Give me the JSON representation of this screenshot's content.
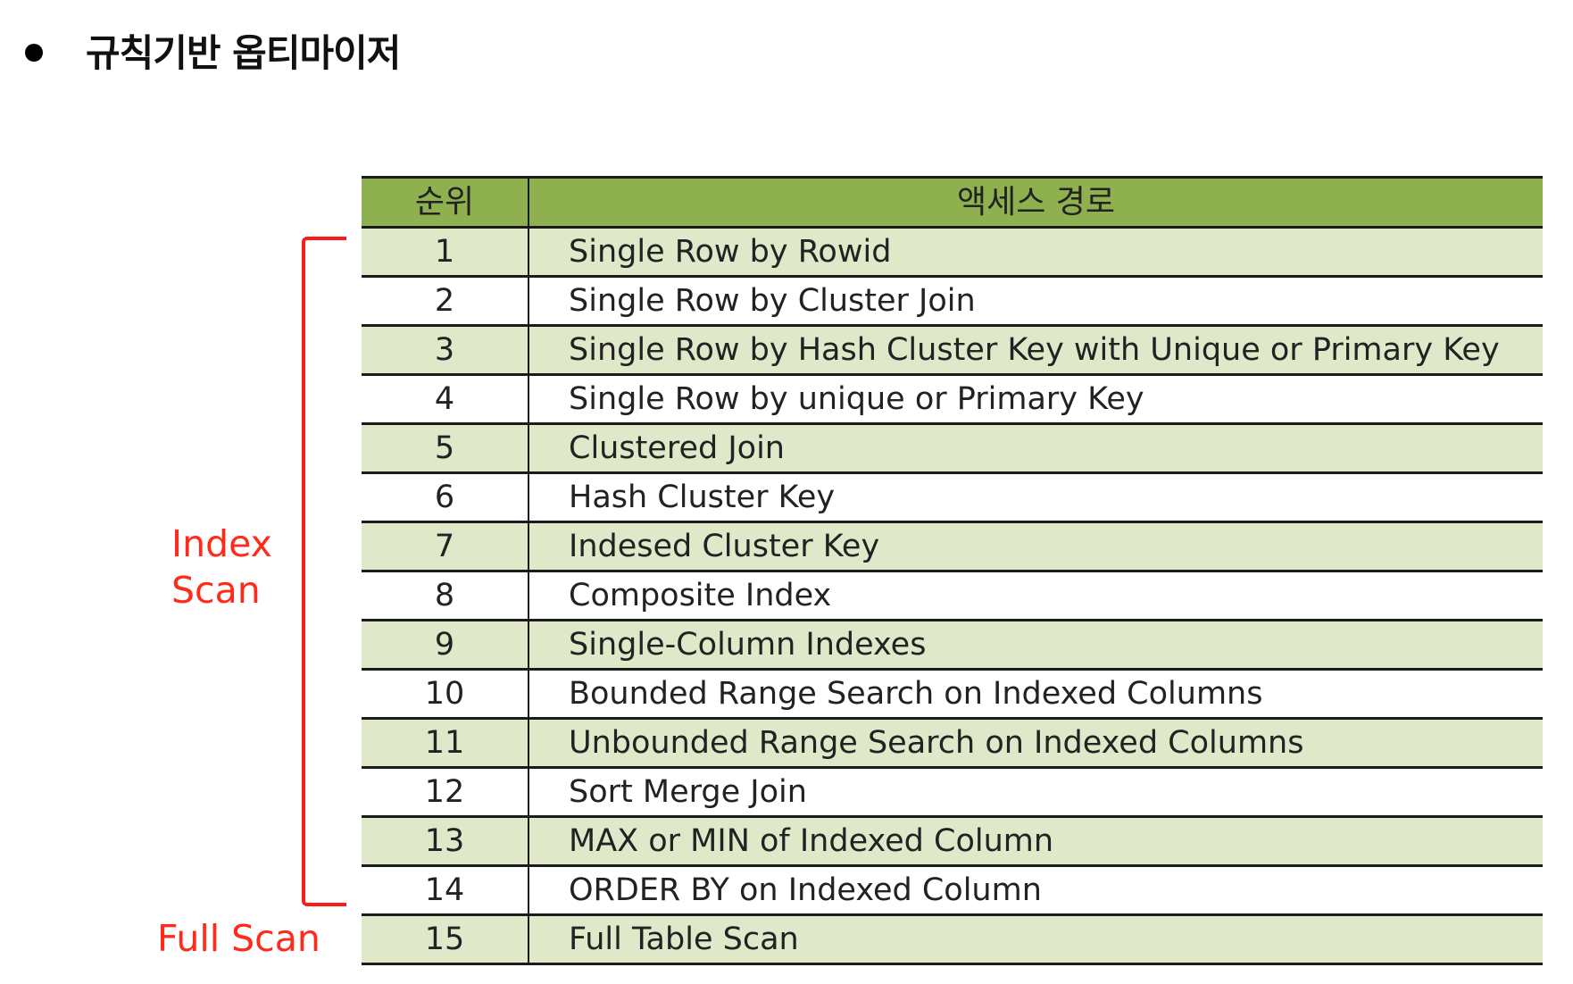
{
  "heading": "규칙기반 옵티마이저",
  "table": {
    "headers": {
      "rank": "순위",
      "path": "액세스 경로"
    },
    "rows": [
      {
        "rank": "1",
        "path": "Single Row by Rowid"
      },
      {
        "rank": "2",
        "path": "Single Row by Cluster Join"
      },
      {
        "rank": "3",
        "path": "Single Row by Hash Cluster Key with Unique or Primary Key"
      },
      {
        "rank": "4",
        "path": "Single Row by unique or Primary Key"
      },
      {
        "rank": "5",
        "path": "Clustered Join"
      },
      {
        "rank": "6",
        "path": "Hash Cluster Key"
      },
      {
        "rank": "7",
        "path": "Indesed Cluster Key"
      },
      {
        "rank": "8",
        "path": "Composite Index"
      },
      {
        "rank": "9",
        "path": "Single-Column Indexes"
      },
      {
        "rank": "10",
        "path": "Bounded Range Search on Indexed Columns"
      },
      {
        "rank": "11",
        "path": "Unbounded Range Search on Indexed Columns"
      },
      {
        "rank": "12",
        "path": "Sort Merge Join"
      },
      {
        "rank": "13",
        "path": "MAX or MIN of Indexed Column"
      },
      {
        "rank": "14",
        "path": "ORDER BY on Indexed Column"
      },
      {
        "rank": "15",
        "path": "Full Table Scan"
      }
    ]
  },
  "annotations": {
    "index_scan_line1": "Index",
    "index_scan_line2": "Scan",
    "full_scan": "Full Scan",
    "color": "#ff2a1a"
  },
  "colors": {
    "header_bg": "#8fb04e",
    "odd_row_bg": "#dfe8c8",
    "even_row_bg": "#ffffff"
  }
}
